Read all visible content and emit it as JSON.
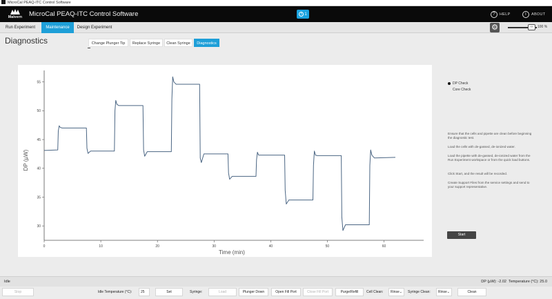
{
  "window": {
    "title": "MicroCal PEAQ-ITC Control Software"
  },
  "header": {
    "logo_text": "Malvern",
    "title": "MicroCal PEAQ-ITC Control Software",
    "badge_count": "1",
    "help_label": "HELP",
    "about_label": "ABOUT"
  },
  "nav": {
    "tabs": [
      {
        "label": "Run Experiment",
        "active": false
      },
      {
        "label": "Maintenance",
        "active": true
      },
      {
        "label": "Design Experiment",
        "active": false
      }
    ],
    "zoom": "100 %"
  },
  "page": {
    "title": "Diagnostics"
  },
  "subtabs": [
    {
      "label": "Change Plunger Tip",
      "active": false
    },
    {
      "label": "Replace Syringe",
      "active": false
    },
    {
      "label": "Clean Syringe",
      "active": false
    },
    {
      "label": "Diagnostics",
      "active": true
    }
  ],
  "chart_data": {
    "type": "line",
    "xlabel": "Time (min)",
    "ylabel": "DP (µW)",
    "xlim": [
      0,
      67
    ],
    "ylim": [
      27.5,
      57
    ],
    "xticks": [
      0,
      10,
      20,
      30,
      40,
      50,
      60
    ],
    "yticks": [
      30,
      35,
      40,
      45,
      50,
      55
    ],
    "grid": false,
    "series": [
      {
        "color": "#4a6583",
        "x": [
          0,
          2.4,
          2.5,
          2.65,
          2.85,
          3.2,
          7.45,
          7.55,
          7.75,
          8.2,
          12.4,
          12.5,
          12.65,
          12.85,
          13.2,
          17.45,
          17.55,
          17.75,
          18.2,
          22.45,
          22.55,
          22.7,
          22.9,
          23.3,
          27.45,
          27.55,
          27.75,
          28.2,
          32.45,
          32.55,
          32.75,
          33.2,
          37.4,
          37.5,
          37.65,
          37.85,
          38.2,
          42.45,
          42.55,
          42.75,
          43.2,
          47.45,
          47.55,
          47.7,
          47.9,
          48.2,
          52.45,
          52.55,
          52.75,
          53.2,
          57.4,
          57.5,
          57.65,
          57.85,
          58.3,
          62
        ],
        "y": [
          43.1,
          43.2,
          46.5,
          47.4,
          47.1,
          47.0,
          47.0,
          43.5,
          42.6,
          43.0,
          43.0,
          50.0,
          51.8,
          51.1,
          50.9,
          50.9,
          43.2,
          42.1,
          42.9,
          42.9,
          52.0,
          55.9,
          55.0,
          54.6,
          54.6,
          41.8,
          41.0,
          42.5,
          42.5,
          39.2,
          38.1,
          38.6,
          38.6,
          41.5,
          42.8,
          42.3,
          42.3,
          42.3,
          36.2,
          33.8,
          34.5,
          34.5,
          40.5,
          43.0,
          42.3,
          42.2,
          42.2,
          31.5,
          29.2,
          30.2,
          30.2,
          40.5,
          43.2,
          42.3,
          41.8,
          41.9
        ]
      }
    ]
  },
  "side": {
    "options": [
      {
        "label": "DP Check",
        "selected": true
      },
      {
        "label": "Core Check",
        "selected": false
      }
    ],
    "instructions": [
      "Ensure that the cells and pipette are clean before beginning the diagnostic test.",
      "Load the cells with de-gassed, de-ionized water.",
      "Load the pipette with de-gassed, de-ionized water from the Run Experiment workspace or from the quick load buttons.",
      "Click Start, and the result will be recorded.",
      "Create Support Files from the service settings and send to your support representative."
    ],
    "start_label": "Start"
  },
  "status": {
    "state": "Idle",
    "dp_readout": "DP (µW): -2.02",
    "temp_readout": "Temperature (°C): 25.0"
  },
  "toolbar": {
    "stop_label": "Stop",
    "idle_temp_label": "Idle Temperature (°C):",
    "idle_temp_value": "25",
    "set_label": "Set",
    "syringe_label": "Syringe:",
    "load_label": "Load",
    "plunger_down_label": "Plunger Down",
    "open_fill_port_label": "Open Fill Port",
    "close_fill_port_label": "Close Fill Port",
    "purge_refill_label": "Purge/Refill",
    "cell_clean_label": "Cell Clean:",
    "cell_clean_value": "Rinse",
    "syringe_clean_label": "Syringe Clean:",
    "syringe_clean_value": "Rinse",
    "clean_label": "Clean"
  }
}
